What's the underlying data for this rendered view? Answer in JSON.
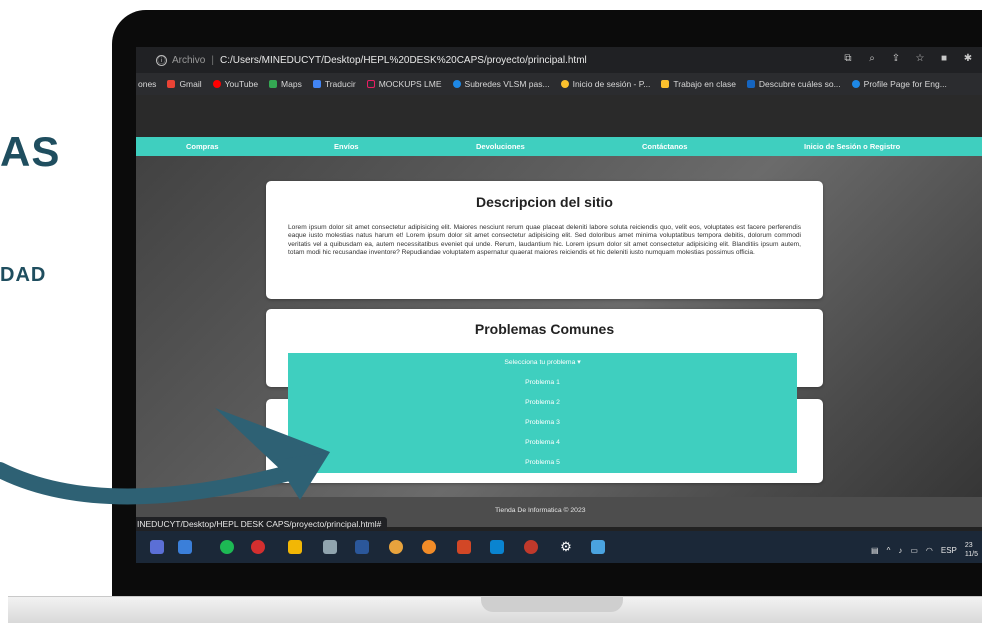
{
  "slide": {
    "fragment_top": "AS",
    "fragment_bottom": "DAD"
  },
  "browser": {
    "info_icon": "ⓘ",
    "scheme": "Archivo",
    "separator": "|",
    "url": "C:/Users/MINEDUCYT/Desktop/HEPL%20DESK%20CAPS/proyecto/principal.html",
    "bookmarks": [
      {
        "label": "ones",
        "color": ""
      },
      {
        "label": "Gmail",
        "color": "#ea4335"
      },
      {
        "label": "YouTube",
        "color": "#ff0000"
      },
      {
        "label": "Maps",
        "color": "#34a853"
      },
      {
        "label": "Traducir",
        "color": "#4285f4"
      },
      {
        "label": "MOCKUPS LME",
        "color": "#e91e63"
      },
      {
        "label": "Subredes VLSM pas...",
        "color": "#1e88e5"
      },
      {
        "label": "Inicio de sesión - P...",
        "color": "#fbc02d"
      },
      {
        "label": "Trabajo en clase",
        "color": "#fbc02d"
      },
      {
        "label": "Descubre cuáles so...",
        "color": "#1565c0"
      },
      {
        "label": "Profile Page for Eng...",
        "color": "#1e88e5"
      }
    ]
  },
  "site": {
    "nav": [
      "Compras",
      "Envíos",
      "Devoluciones",
      "Contáctanos",
      "Inicio de Sesión o Registro"
    ],
    "description": {
      "title": "Descripcion del sitio",
      "body": "Lorem ipsum dolor sit amet consectetur adipisicing elit. Maiores nesciunt rerum quae placeat deleniti labore soluta reiciendis quo, velit eos, voluptates est facere perferendis eaque iusto molestias natus harum et! Lorem ipsum dolor sit amet consectetur adipisicing elit. Sed doloribus amet minima voluptatibus tempora debitis, dolorum commodi veritatis vel a quibusdam ea, autem necessitatibus eveniet qui unde. Rerum, laudantium hic. Lorem ipsum dolor sit amet consectetur adipisicing elit. Blanditiis ipsum autem, totam modi hic recusandae inventore? Repudiandae voluptatem aspernatur quaerat maiores reiciendis et hic deleniti iusto numquam molestias possimus officia."
    },
    "problems": {
      "title": "Problemas Comunes",
      "toggle": "Selecciona tu problema ▾",
      "items": [
        "Problema 1",
        "Problema 2",
        "Problema 3",
        "Problema 4",
        "Problema 5"
      ]
    },
    "footer": "Tienda De Informatica © 2023",
    "status_url": "INEDUCYT/Desktop/HEPL DESK CAPS/proyecto/principal.html#"
  },
  "taskbar": {
    "tray_language": "ESP",
    "tray_time": "23",
    "tray_date": "11/5"
  },
  "colors": {
    "accent": "#3fcfbf",
    "slide_text": "#1f4e5f",
    "arrow": "#2e6174"
  }
}
